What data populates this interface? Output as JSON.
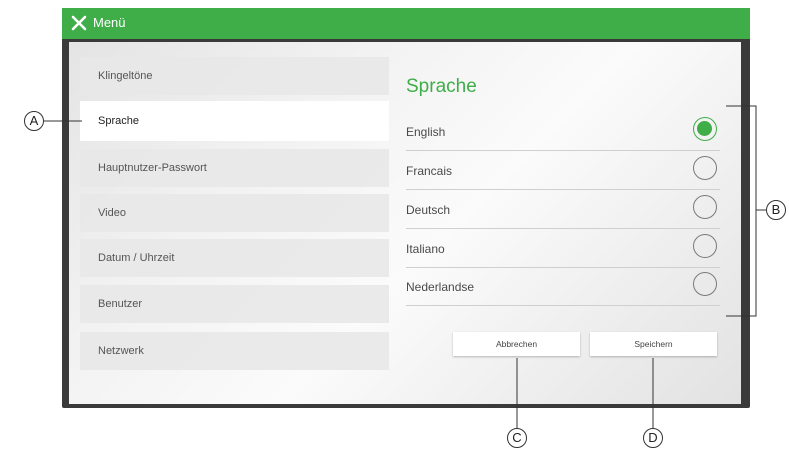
{
  "header": {
    "title": "Menü",
    "close_icon": "close-icon"
  },
  "menu": {
    "items": [
      {
        "label": "Klingeltöne",
        "active": false
      },
      {
        "label": "Sprache",
        "active": true
      },
      {
        "label": "Hauptnutzer-Passwort",
        "active": false
      },
      {
        "label": "Video",
        "active": false
      },
      {
        "label": "Datum / Uhrzeit",
        "active": false
      },
      {
        "label": "Benutzer",
        "active": false
      },
      {
        "label": "Netzwerk",
        "active": false
      }
    ]
  },
  "language": {
    "heading": "Sprache",
    "options": [
      {
        "label": "English",
        "selected": true
      },
      {
        "label": "Francais",
        "selected": false
      },
      {
        "label": "Deutsch",
        "selected": false
      },
      {
        "label": "Italiano",
        "selected": false
      },
      {
        "label": "Nederlandse",
        "selected": false
      }
    ]
  },
  "buttons": {
    "cancel": "Abbrechen",
    "save": "Speichern"
  },
  "callouts": {
    "a": "A",
    "b": "B",
    "c": "C",
    "d": "D"
  },
  "colors": {
    "accent": "#3fae49",
    "frame": "#3a3a3a"
  }
}
